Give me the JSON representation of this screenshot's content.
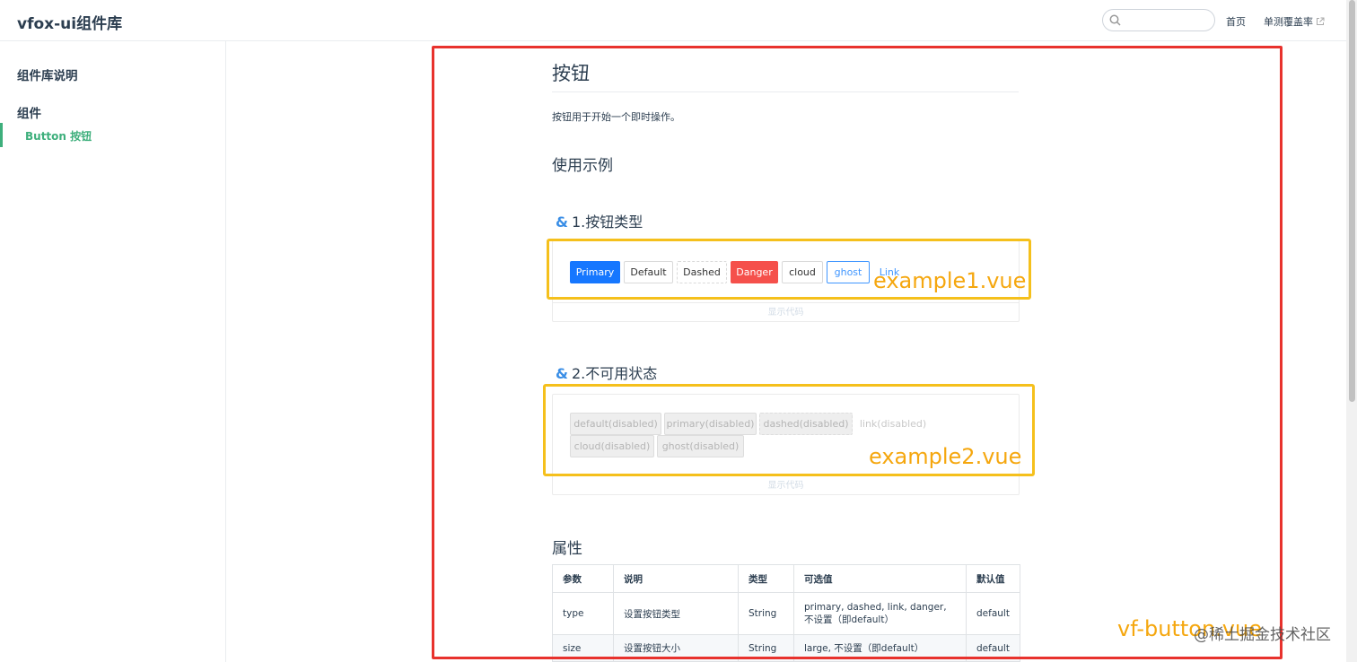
{
  "header": {
    "site_name": "vfox-ui组件库",
    "search_placeholder": "",
    "nav_home": "首页",
    "nav_coverage": "单测覆盖率"
  },
  "sidebar": {
    "group1": "组件库说明",
    "group2": "组件",
    "active_item": "Button 按钮"
  },
  "main": {
    "title": "按钮",
    "description": "按钮用于开始一个即时操作。",
    "usage_heading": "使用示例",
    "section1": {
      "amp": "&",
      "title": "1.按钮类型"
    },
    "section2": {
      "amp": "&",
      "title": "2.不可用状态"
    },
    "show_code": "显示代码",
    "buttons_example1": [
      "Primary",
      "Default",
      "Dashed",
      "Danger",
      "cloud",
      "ghost",
      "Link"
    ],
    "buttons_example2": [
      "default(disabled)",
      "primary(disabled)",
      "dashed(disabled)",
      "link(disabled)",
      "cloud(disabled)",
      "ghost(disabled)"
    ],
    "props_heading": "属性",
    "table": {
      "headers": [
        "参数",
        "说明",
        "类型",
        "可选值",
        "默认值"
      ],
      "rows": [
        [
          "type",
          "设置按钮类型",
          "String",
          "primary, dashed, link, danger, 不设置（即default）",
          "default"
        ],
        [
          "size",
          "设置按钮大小",
          "String",
          "large, 不设置（即default）",
          "default"
        ]
      ]
    }
  },
  "annotations": {
    "example1": "example1.vue",
    "example2": "example2.vue",
    "component": "vf-button.vue",
    "watermark": "@稀土掘金技术社区"
  },
  "colors": {
    "accent_green": "#3eaf7c",
    "primary_blue": "#1677ff",
    "danger_red": "#f5504b",
    "annotation_red": "#e8322d",
    "annotation_yellow": "#f5c01c"
  }
}
